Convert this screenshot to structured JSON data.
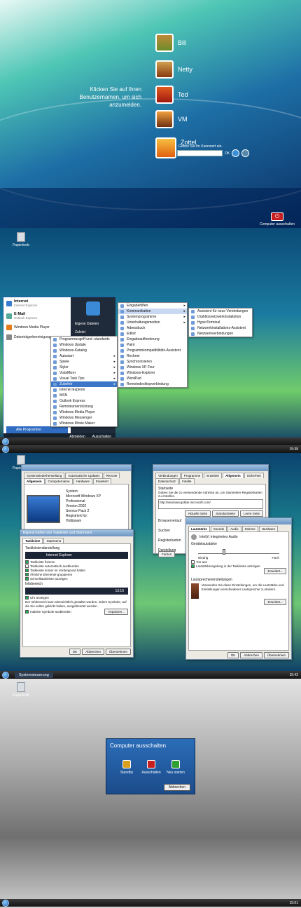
{
  "logon": {
    "prompt": "Klicken Sie auf Ihren Benutzernamen, um sich anzumelden.",
    "users": [
      "Bill",
      "Netty",
      "Ted",
      "VM",
      "Zottel"
    ],
    "password_hint": "Geben Sie Ihr Kennwort ein.",
    "ok_label": "OK",
    "shutdown_label": "Computer ausschalten"
  },
  "desktop": {
    "recycle": "Papierkorb"
  },
  "startmenu": {
    "pinned": [
      {
        "title": "Internet",
        "sub": "Internet Explorer"
      },
      {
        "title": "E-Mail",
        "sub": "Outlook Express"
      },
      {
        "title": "Windows Media Player",
        "sub": ""
      },
      {
        "title": "Datenträgerbereinigung",
        "sub": ""
      }
    ],
    "right": [
      "Eigene Dateien",
      "Zuletzt"
    ],
    "all_programs": "Alle Programme",
    "logoff": "Abmelden",
    "shutdown": "Ausschalten",
    "programs": [
      "Programmzugriff und -standards",
      "Windows Update",
      "Windows-Katalog",
      "Autostart",
      "Spiele",
      "Styler",
      "VistaMizer",
      "Visual Task Tips",
      "Zubehör",
      "Internet Explorer",
      "MSN",
      "Outlook Express",
      "Remoteunterstützung",
      "Windows Media Player",
      "Windows Messenger",
      "Windows Movie Maker"
    ],
    "accessories": [
      "Eingabehilfen",
      "Kommunikation",
      "Systemprogramme",
      "Unterhaltungsmedien",
      "Adressbuch",
      "Editor",
      "Eingabeaufforderung",
      "Paint",
      "Programmkompatibilitäts-Assistent",
      "Rechner",
      "Synchronisieren",
      "Windows XP-Tour",
      "Windows-Explorer",
      "WordPad",
      "Remotedesktopverbindung"
    ],
    "communication": [
      "Assistent für neue Verbindungen",
      "Drahtlosnetzwerkinstallation",
      "HyperTerminal",
      "Netzwerkinstallations-Assistent",
      "Netzwerkverbindungen"
    ]
  },
  "screen3": {
    "clock": "15:38",
    "sysprops": {
      "tabs": [
        "Systemwiederherstellung",
        "Automatische Updates",
        "Remote",
        "Allgemein",
        "Computername",
        "Hardware",
        "Erweitert"
      ],
      "lines": [
        "System:",
        "Microsoft Windows XP",
        "Professional",
        "Version 2002",
        "Service Pack 2",
        "Registriert für:",
        "Hottipawn"
      ]
    },
    "taskbarprops": {
      "title": "Eigenschaften von Taskleiste und Startmenü",
      "tabs": [
        "Taskleiste",
        "Startmenü"
      ],
      "section1": "Taskleistendarstellung",
      "preview": "Internet Explorer",
      "checks": [
        "Taskleiste fixieren",
        "Taskleiste automatisch ausblenden",
        "Taskleiste immer im Vordergrund halten",
        "Ähnliche Elemente gruppieren",
        "Schnellstartleiste anzeigen"
      ],
      "section2": "Infobereich",
      "clock_check": "Uhr anzeigen",
      "info": "Der Infobereich kann übersichtlich gestaltet werden, indem Symbole, auf die Sie selten geklickt haben, ausgeblendet werden.",
      "hide_check": "Inaktive Symbole ausblenden",
      "customize": "Anpassen...",
      "ok": "OK",
      "cancel": "Abbrechen",
      "apply": "Übernehmen",
      "preview_clock": "13:16"
    },
    "inetopts": {
      "tabs": [
        "Verbindungen",
        "Programme",
        "Erweitert",
        "Allgemein",
        "Sicherheit",
        "Datenschutz",
        "Inhalte"
      ],
      "start_label": "Startseite",
      "start_desc": "Geben Sie die zu verwendende Adresse an, um Startseiten-Registerkarten zu erstellen.",
      "url": "http://windowsupdate.microsoft.com/",
      "buttons": [
        "Aktuelle Seite",
        "Standardseite",
        "Leere Seite"
      ],
      "history": "Browserverlauf",
      "search": "Suchen",
      "tabs_label": "Registerkarten",
      "display": "Darstellung",
      "colors": "Farben"
    },
    "sound": {
      "tabs": [
        "Lautstärke",
        "Sounds",
        "Audio",
        "Stimme",
        "Hardware"
      ],
      "device": "Intel(r) integriertes Audio",
      "volume": "Gerätelautstärke",
      "low": "Niedrig",
      "high": "Hoch",
      "mute": "Ton aus",
      "tray": "Lautstärkeregelung in der Taskleiste anzeigen",
      "advanced": "Erweitert...",
      "speaker_section": "Lautsprechereinstellungen",
      "speaker_desc": "Verwenden Sie diese Einstellungen, um die Lautstärke und Einstellungen verschiedener Lautsprecher zu ändern.",
      "advanced2": "Erweitert...",
      "ok": "OK",
      "cancel": "Abbrechen",
      "apply": "Übernehmen"
    }
  },
  "screen4": {
    "taskbar_app": "Systemsteuerung",
    "clock": "15:42",
    "recycle": "Papierkorb",
    "dialog_title": "Computer ausschalten",
    "standby": "Standby",
    "off": "Ausschalten",
    "restart": "Neu starten",
    "cancel": "Abbrechen",
    "clock2": "15:01"
  }
}
